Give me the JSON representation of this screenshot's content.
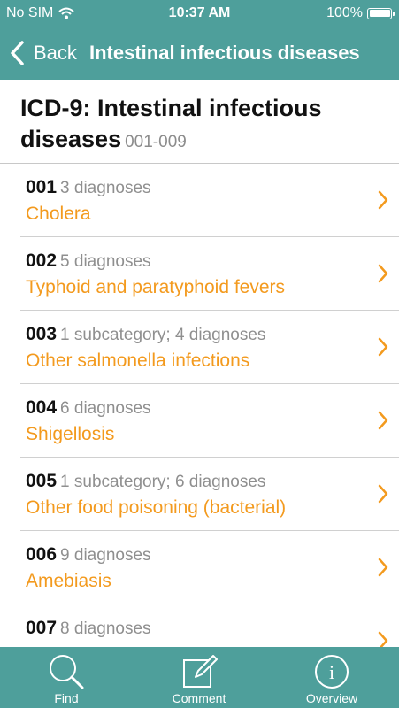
{
  "status": {
    "carrier": "No SIM",
    "time": "10:37 AM",
    "battery": "100%"
  },
  "nav": {
    "back_label": "Back",
    "title": "Intestinal infectious diseases"
  },
  "header": {
    "title": "ICD-9: Intestinal infectious diseases",
    "range": "001-009"
  },
  "list": [
    {
      "code": "001",
      "meta": "3 diagnoses",
      "name": "Cholera"
    },
    {
      "code": "002",
      "meta": "5 diagnoses",
      "name": "Typhoid and paratyphoid fevers"
    },
    {
      "code": "003",
      "meta": "1 subcategory; 4 diagnoses",
      "name": "Other salmonella infections"
    },
    {
      "code": "004",
      "meta": "6 diagnoses",
      "name": "Shigellosis"
    },
    {
      "code": "005",
      "meta": "1 subcategory; 6 diagnoses",
      "name": "Other food poisoning (bacterial)"
    },
    {
      "code": "006",
      "meta": "9 diagnoses",
      "name": "Amebiasis"
    },
    {
      "code": "007",
      "meta": "8 diagnoses",
      "name": ""
    }
  ],
  "tabs": [
    {
      "label": "Find",
      "icon": "magnifier-icon"
    },
    {
      "label": "Comment",
      "icon": "compose-icon"
    },
    {
      "label": "Overview",
      "icon": "info-icon"
    }
  ],
  "colors": {
    "brand": "#4e9f9b",
    "accent": "#f39a1e"
  }
}
